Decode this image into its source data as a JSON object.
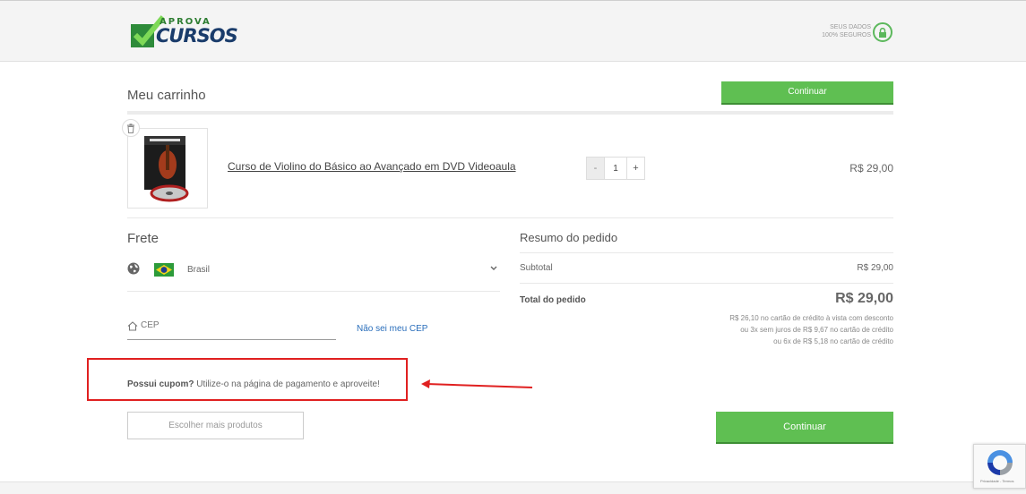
{
  "header": {
    "logo": {
      "top_text": "APROVA",
      "main_text": "CURSOS"
    },
    "secure_badge": {
      "line1": "SEUS DADOS",
      "line2": "100% SEGUROS"
    }
  },
  "cart": {
    "title": "Meu carrinho",
    "continue_top_label": "Continuar",
    "item": {
      "name": "Curso de Violino do Básico ao Avançado em DVD Videoaula",
      "quantity": "1",
      "minus": "-",
      "plus": "+",
      "price": "R$ 29,00"
    }
  },
  "shipping": {
    "title": "Frete",
    "country": "Brasil",
    "cep_placeholder": "CEP",
    "cep_link": "Não sei meu CEP"
  },
  "summary": {
    "title": "Resumo do pedido",
    "subtotal_label": "Subtotal",
    "subtotal_value": "R$ 29,00",
    "total_label": "Total do pedido",
    "total_value": "R$ 29,00",
    "installments": [
      "R$ 26,10 no cartão de crédito à vista com desconto",
      "ou 3x sem juros de R$ 9,67 no cartão de crédito",
      "ou 6x de R$ 5,18 no cartão de crédito"
    ]
  },
  "coupon": {
    "bold": "Possui cupom?",
    "text": " Utilize-o na página de pagamento e aproveite!"
  },
  "actions": {
    "more_products": "Escolher mais produtos",
    "continue_bottom": "Continuar"
  },
  "recaptcha": {
    "text": "Privacidade - Termos"
  },
  "colors": {
    "accent": "#5fbf52",
    "highlight": "#e02020",
    "link": "#2a6ebb"
  }
}
